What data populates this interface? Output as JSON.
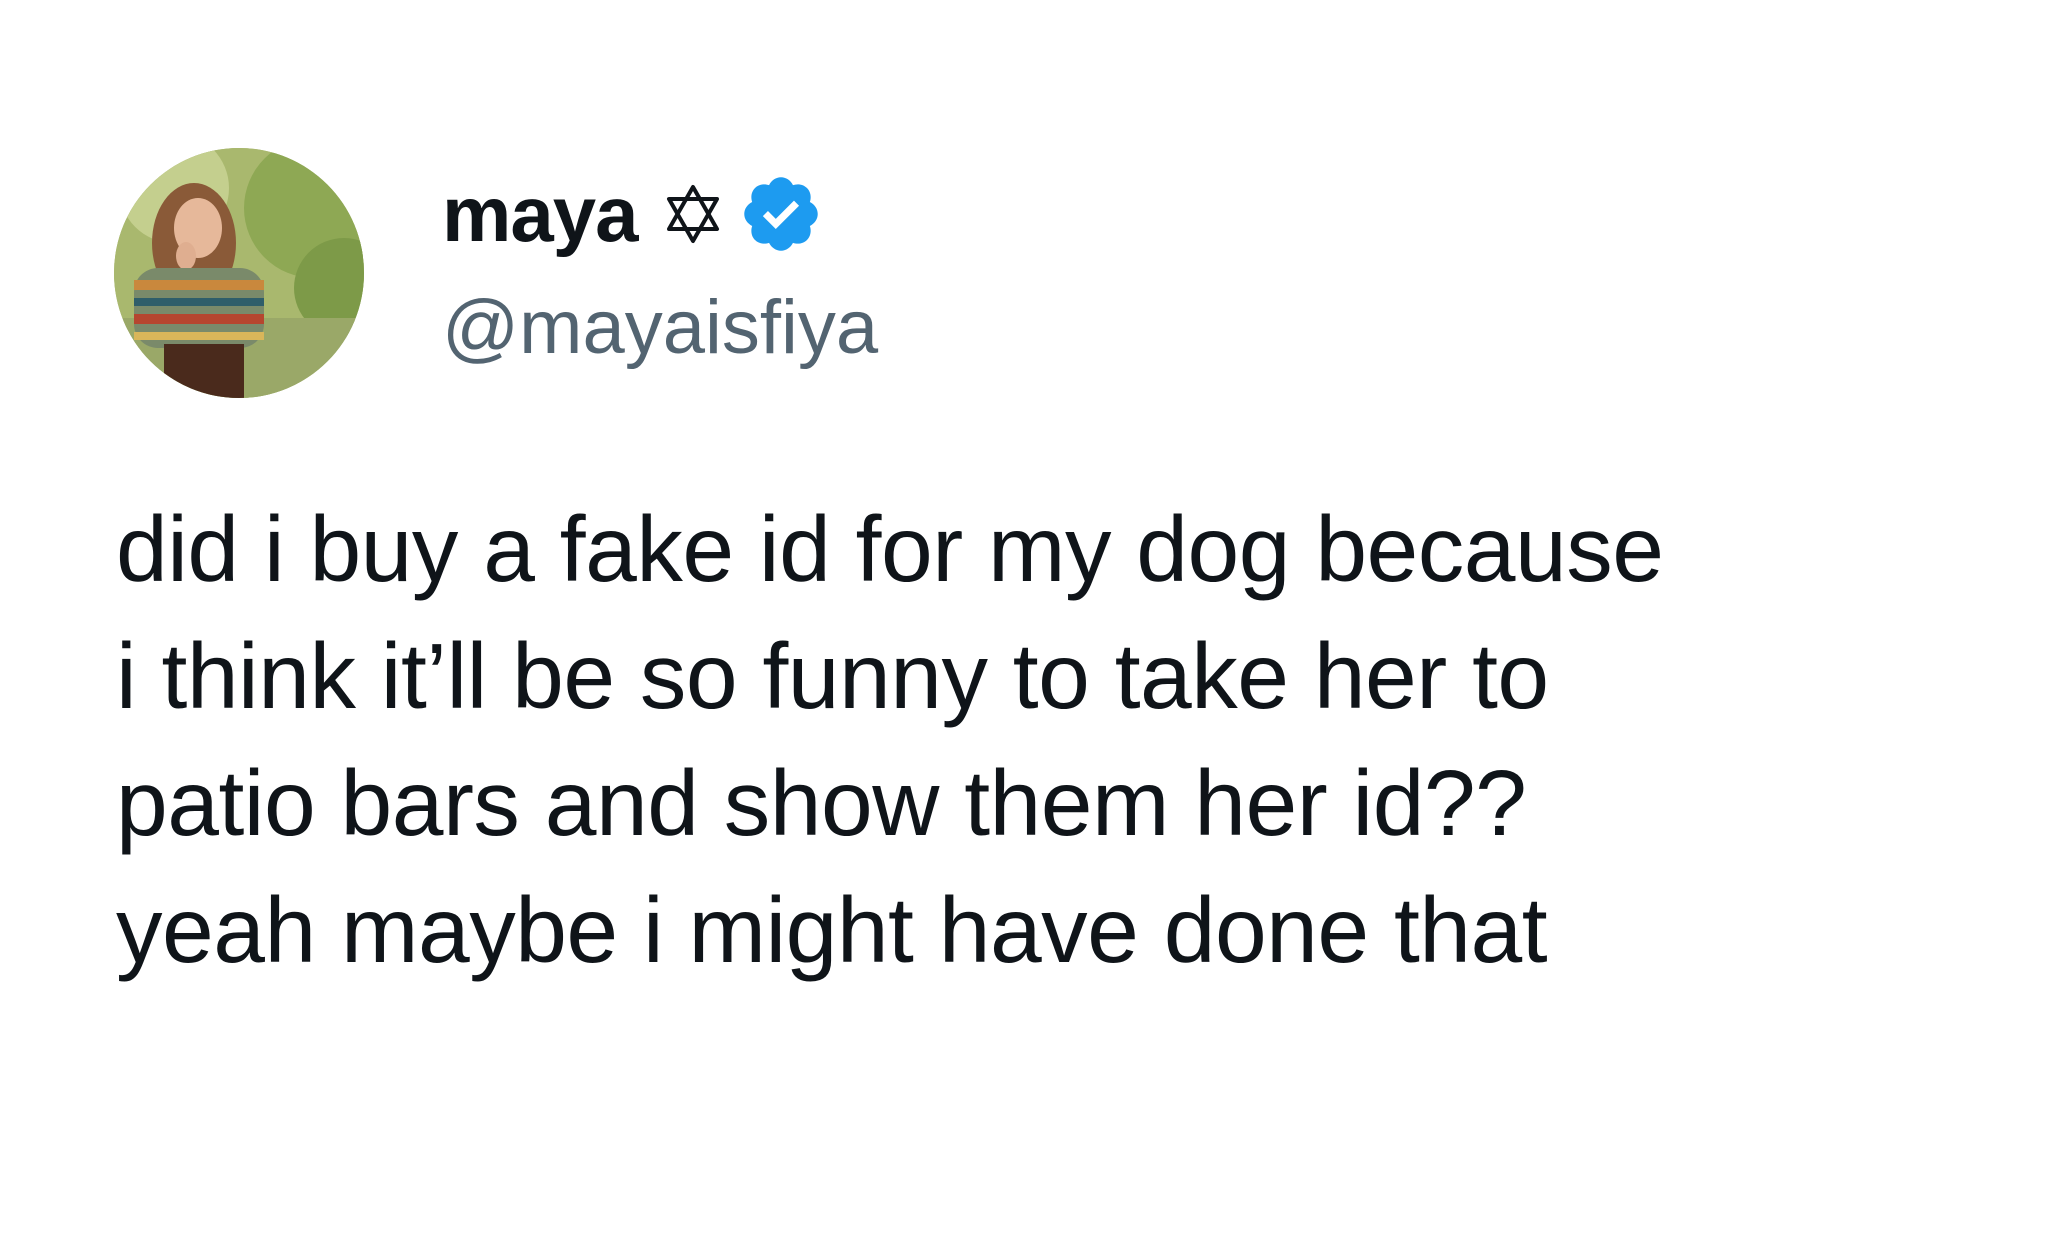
{
  "tweet": {
    "author": {
      "display_name": "maya",
      "handle": "@mayaisfiya",
      "name_emoji_icon": "star-of-david-icon",
      "verified_icon": "verified-badge-icon",
      "verified_color": "#1d9bf0"
    },
    "text_lines": [
      "did i buy a fake id for my dog because",
      "i think it’ll be so funny to take her to",
      "patio bars and show them her id??",
      "yeah maybe i might have done that"
    ]
  },
  "colors": {
    "background": "#ffffff",
    "text": "#0f1419",
    "handle": "#536471"
  }
}
